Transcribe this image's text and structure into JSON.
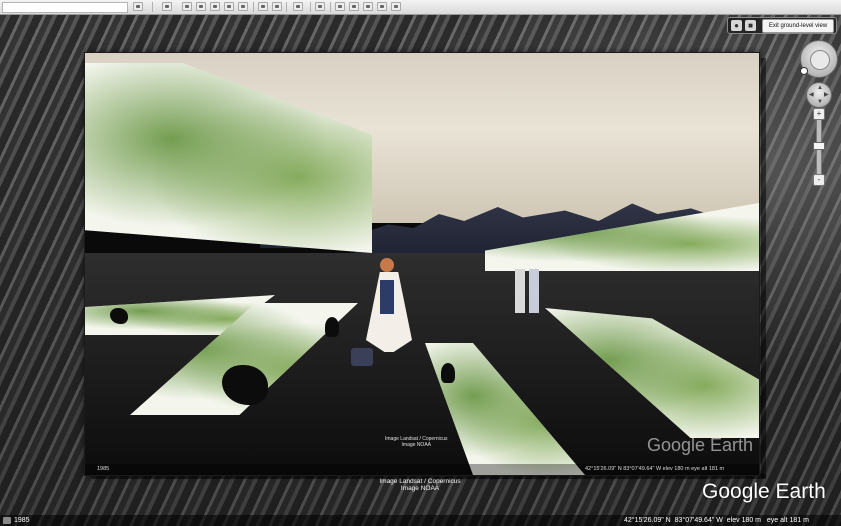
{
  "toolbar": {
    "search_placeholder": "",
    "buttons": [
      "search-button",
      "toggle-sidebar-button",
      "add-placemark-button",
      "add-polygon-button",
      "add-path-button",
      "add-overlay-button",
      "record-tour-button",
      "historical-imagery-button",
      "sunlight-button",
      "switch-planet-button",
      "ruler-button",
      "email-button",
      "print-button",
      "save-image-button",
      "view-in-maps-button"
    ]
  },
  "ground_view": {
    "exit_label": "Exit ground-level view",
    "person_icon": "person-icon",
    "cube_icon": "cube-icon"
  },
  "navigation": {
    "look_icon": "look-joystick-icon",
    "move_icon": "move-joystick-icon",
    "zoom_in": "+",
    "zoom_out": "-"
  },
  "photo": {
    "credit_lines": [
      "Image Landsat / Copernicus",
      "Image NOAA"
    ],
    "logo": "Google Earth",
    "status_year": "1985",
    "status_coords": "42°15'26.09\" N   83°07'49.64\" W   elev  180 m      eye alt   181 m"
  },
  "credits": {
    "line1": "Image Landsat / Copernicus",
    "line2": "Image NOAA"
  },
  "logo": "Google Earth",
  "status": {
    "year": "1985",
    "lat": "42°15'26.09\" N",
    "lon": "83°07'49.64\" W",
    "elev_label": "elev",
    "elev": "180 m",
    "eye_label": "eye alt",
    "eye": "181 m"
  }
}
